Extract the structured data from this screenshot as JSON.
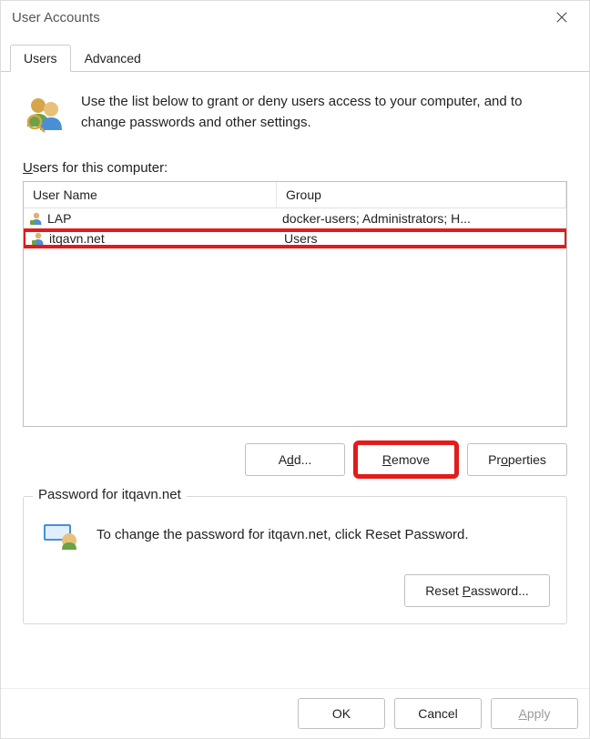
{
  "window": {
    "title": "User Accounts"
  },
  "tabs": {
    "users": "Users",
    "advanced": "Advanced"
  },
  "intro": "Use the list below to grant or deny users access to your computer, and to change passwords and other settings.",
  "users_label_prefix": "U",
  "users_label_rest": "sers for this computer:",
  "table": {
    "header_name": "User Name",
    "header_group": "Group",
    "rows": [
      {
        "name": "LAP",
        "group": "docker-users; Administrators; H..."
      },
      {
        "name": "itqavn.net",
        "group": "Users"
      }
    ]
  },
  "buttons": {
    "add_pre": "A",
    "add_u": "d",
    "add_post": "d...",
    "remove_u": "R",
    "remove_post": "emove",
    "properties_pre": "Pr",
    "properties_u": "o",
    "properties_post": "perties",
    "reset_pre": "Reset ",
    "reset_u": "P",
    "reset_post": "assword...",
    "ok": "OK",
    "cancel": "Cancel",
    "apply_u": "A",
    "apply_post": "pply"
  },
  "password_section": {
    "legend": "Password for itqavn.net",
    "text": "To change the password for itqavn.net, click Reset Password."
  }
}
